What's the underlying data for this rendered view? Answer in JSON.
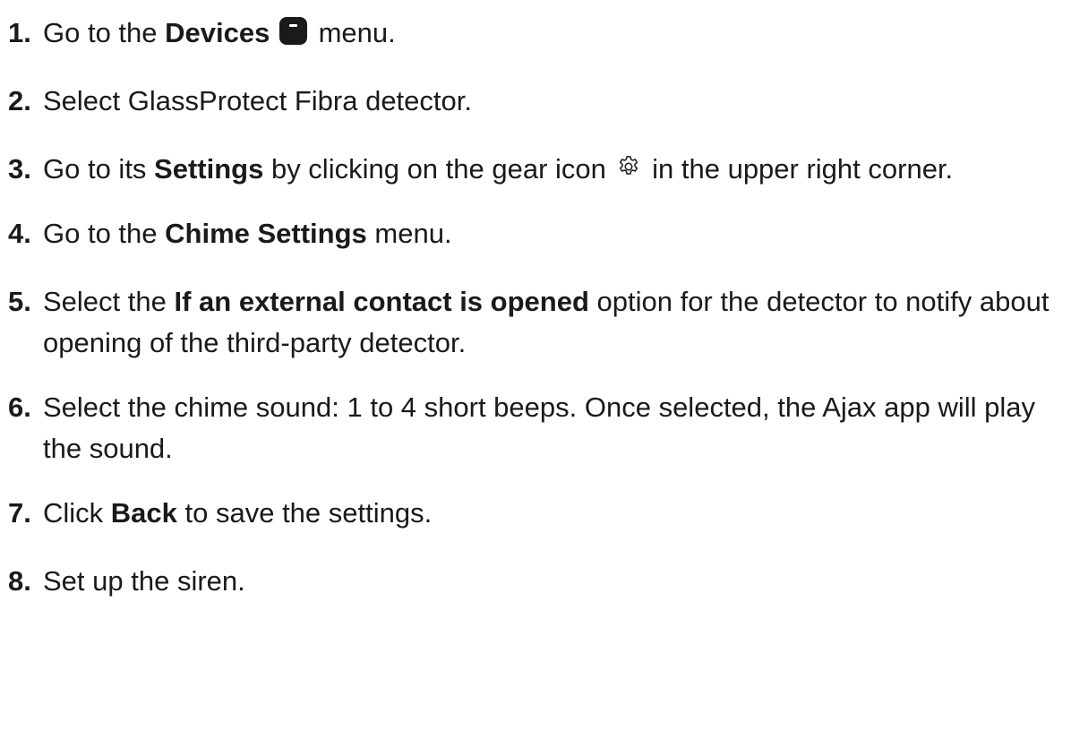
{
  "steps": [
    {
      "number": "1.",
      "before": "Go to the ",
      "bold": "Devices",
      "icon": "devices-icon",
      "after": " menu."
    },
    {
      "number": "2.",
      "text": "Select GlassProtect Fibra detector."
    },
    {
      "number": "3.",
      "before": "Go to its ",
      "bold": "Settings",
      "middle": " by clicking on the gear icon ",
      "icon": "gear-icon",
      "after": " in the upper right corner."
    },
    {
      "number": "4.",
      "before": "Go to the ",
      "bold": "Chime Settings",
      "after": " menu."
    },
    {
      "number": "5.",
      "before": "Select the ",
      "bold": "If an external contact is opened",
      "after": " option for the detector to notify about opening of the third-party detector."
    },
    {
      "number": "6.",
      "text": "Select the chime sound: 1 to 4 short beeps. Once selected, the Ajax app will play the sound."
    },
    {
      "number": "7.",
      "before": "Click ",
      "bold": "Back",
      "after": " to save the settings."
    },
    {
      "number": "8.",
      "text": "Set up the siren."
    }
  ]
}
